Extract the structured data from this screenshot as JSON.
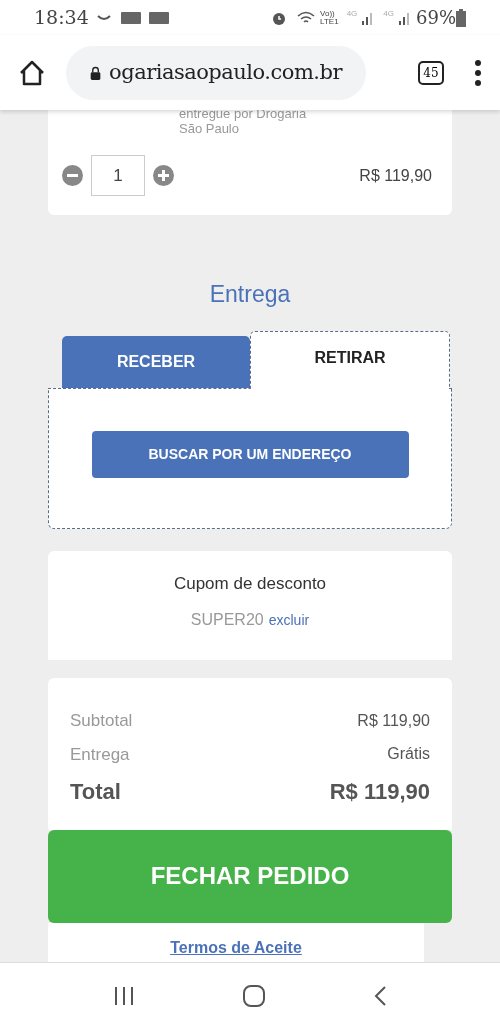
{
  "status_bar": {
    "time": "18:34",
    "network": "Vo))",
    "network_sub": "LTE1",
    "net_a": "4G",
    "net_b": "4G",
    "battery": "69%"
  },
  "browser": {
    "url": "ogariasaopaulo.com.br",
    "tab_count": "45"
  },
  "cart_item": {
    "seller_line_1": "entregue por Drogaria",
    "seller_line_2": "São Paulo",
    "quantity": "1",
    "price": "R$ 119,90"
  },
  "delivery": {
    "heading": "Entrega",
    "tabs": [
      {
        "label": "RECEBER",
        "selected": false
      },
      {
        "label": "RETIRAR",
        "selected": true
      }
    ],
    "button": "BUSCAR POR UM ENDEREÇO"
  },
  "coupon": {
    "title": "Cupom de desconto",
    "code": "SUPER20",
    "remove_link": "excluir"
  },
  "summary": {
    "rows": [
      {
        "label": "Subtotal",
        "value": "R$ 119,90",
        "kind": "normal"
      },
      {
        "label": "Entrega",
        "value": "Grátis",
        "kind": "normal"
      },
      {
        "label": "Total",
        "value": "R$ 119,90",
        "kind": "total"
      }
    ]
  },
  "checkout_button": "FECHAR PEDIDO",
  "terms_link": "Termos de Aceite"
}
